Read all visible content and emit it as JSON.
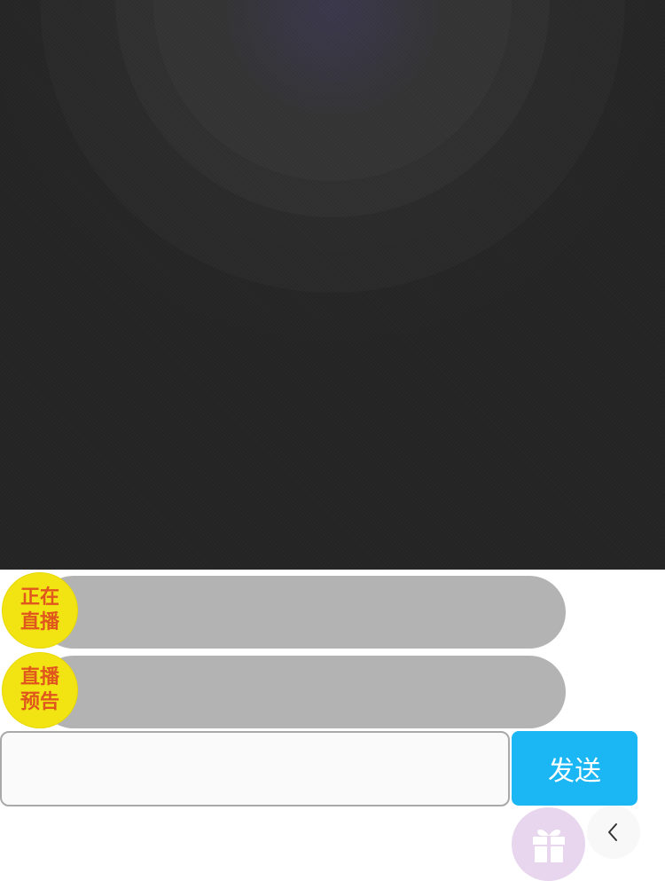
{
  "tabs": {
    "live": {
      "label_line1": "正在",
      "label_line2": "直播"
    },
    "preview": {
      "label_line1": "直播",
      "label_line2": "预告"
    }
  },
  "chat": {
    "input_value": "",
    "input_placeholder": "",
    "send_label": "发送"
  },
  "icons": {
    "gift": "gift-icon",
    "back": "back-arrow-icon"
  },
  "colors": {
    "player_bg": "#242424",
    "badge_bg": "#f2e312",
    "badge_text": "#e0571e",
    "tab_bar": "#b3b3b3",
    "send_bg": "#1bb7f4",
    "gift_bg": "#e8d6ef"
  }
}
